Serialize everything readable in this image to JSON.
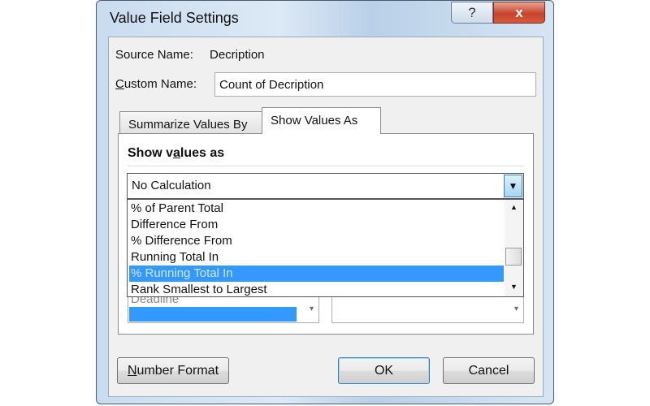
{
  "window": {
    "title": "Value Field Settings",
    "help_label": "?",
    "close_label": "x"
  },
  "source_name": {
    "label": "Source Name:",
    "value": "Decription"
  },
  "custom_name": {
    "label_underline": "C",
    "label_rest": "ustom Name:",
    "value": "Count of Decription"
  },
  "tabs": [
    {
      "label": "Summarize Values By",
      "active": false
    },
    {
      "label": "Show Values As",
      "active": true
    }
  ],
  "show_values_as": {
    "heading_pre": "Show v",
    "heading_underline": "a",
    "heading_post": "lues as",
    "selected": "No Calculation",
    "options": [
      {
        "label": "% of Parent Total",
        "selected": false
      },
      {
        "label": "Difference From",
        "selected": false
      },
      {
        "label": "% Difference From",
        "selected": false
      },
      {
        "label": "Running Total In",
        "selected": false
      },
      {
        "label": "% Running Total In",
        "selected": true
      },
      {
        "label": "Rank Smallest to Largest",
        "selected": false
      }
    ]
  },
  "base_field": {
    "partial_visible_item": "Deadline"
  },
  "buttons": {
    "number_format_underline": "N",
    "number_format_rest": "umber Format",
    "ok": "OK",
    "cancel": "Cancel"
  },
  "colors": {
    "selection": "#3399ff",
    "close": "#c8432c"
  }
}
